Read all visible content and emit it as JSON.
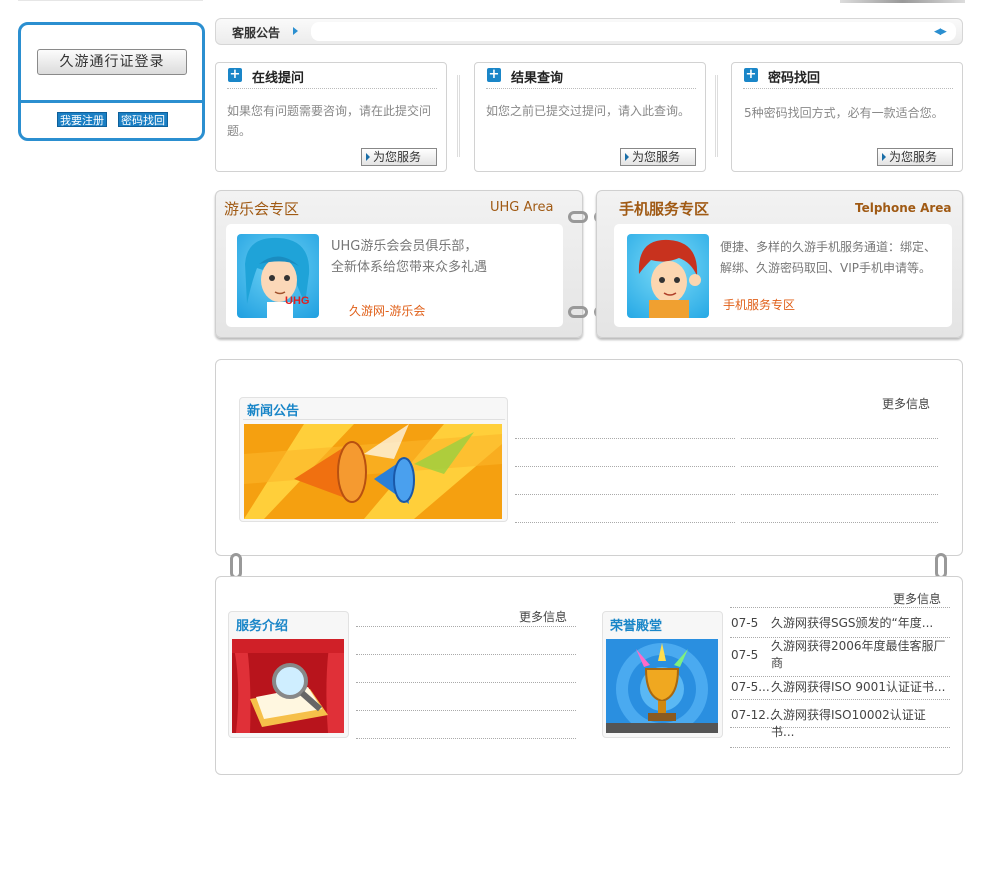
{
  "login": {
    "title": "久游通行证登录",
    "register": "我要注册",
    "recover": "密码找回"
  },
  "notice": {
    "label": "客服公告"
  },
  "services": [
    {
      "title": "在线提问",
      "text": "如果您有问题需要咨询，请在此提交问题。",
      "button": "为您服务"
    },
    {
      "title": "结果查询",
      "text": "如您之前已提交过提问，请入此查询。",
      "button": "为您服务"
    },
    {
      "title": "密码找回",
      "text": "5种密码找回方式，必有一款适合您。",
      "button": "为您服务"
    }
  ],
  "uhg_zone": {
    "title": "游乐会专区",
    "subtitle": "UHG Area",
    "line1": "UHG游乐会会员俱乐部，",
    "line2": "全新体系给您带来众多礼遇",
    "link": "久游网-游乐会",
    "badge": "UHG"
  },
  "mobile_zone": {
    "title": "手机服务专区",
    "subtitle": "Telphone Area",
    "line1": "便捷、多样的久游手机服务通道：绑定、",
    "line2": "解绑、久游密码取回、VIP手机申请等。",
    "link": "手机服务专区"
  },
  "news": {
    "title": "新闻公告",
    "more": "更多信息"
  },
  "service_intro": {
    "title": "服务介绍",
    "more": "更多信息"
  },
  "honor": {
    "title": "荣誉殿堂",
    "more": "更多信息",
    "items": [
      {
        "date": "07-5",
        "text": "久游网获得SGS颁发的“年度..."
      },
      {
        "date": "07-5",
        "text": "久游网获得2006年度最佳客服厂商"
      },
      {
        "date": "07-5...",
        "text": "久游网获得ISO 9001认证证书..."
      },
      {
        "date": "07-12...",
        "text": "久游网获得ISO10002认证证书..."
      }
    ]
  },
  "colors": {
    "accent": "#2b8fd0",
    "zone_title": "#a05a14",
    "link_orange": "#e0601a"
  }
}
